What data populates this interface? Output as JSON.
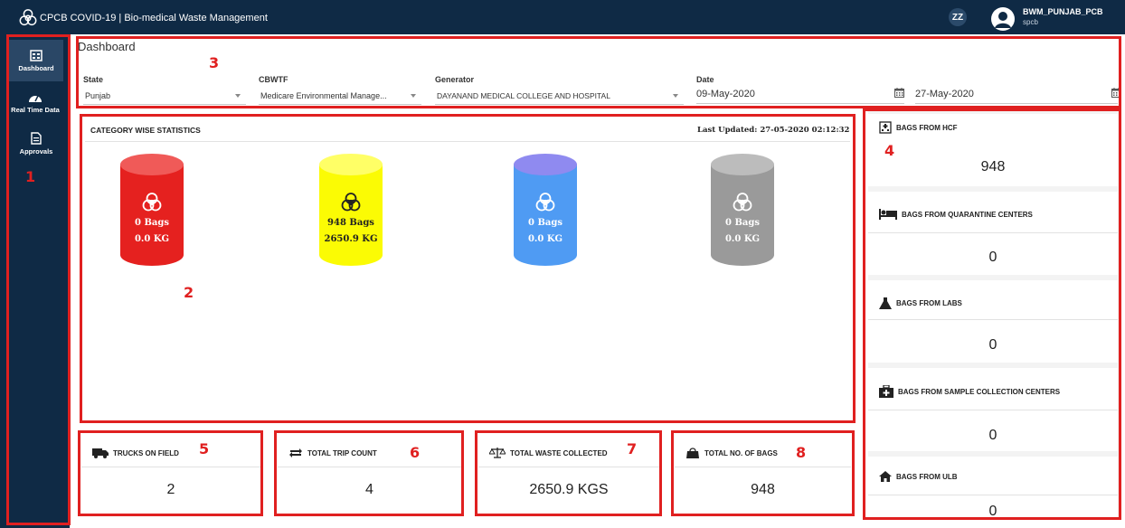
{
  "header": {
    "title": "CPCB COVID-19 | Bio-medical Waste Management",
    "user_name": "BWM_PUNJAB_PCB",
    "user_org": "spcb",
    "badge": "ZZ"
  },
  "sidebar": {
    "items": [
      {
        "label": "Dashboard",
        "icon": "dashboard-icon",
        "active": true
      },
      {
        "label": "Real Time Data",
        "icon": "speedometer-icon",
        "active": false
      },
      {
        "label": "Approvals",
        "icon": "document-icon",
        "active": false
      }
    ]
  },
  "filters": {
    "page_title": "Dashboard",
    "state": {
      "label": "State",
      "value": "Punjab"
    },
    "cbwtf": {
      "label": "CBWTF",
      "value": "Medicare Environmental Manage..."
    },
    "generator": {
      "label": "Generator",
      "value": "DAYANAND MEDICAL COLLEGE AND HOSPITAL"
    },
    "date": {
      "label": "Date",
      "from": "09-May-2020",
      "to": "27-May-2020"
    }
  },
  "category_stats": {
    "title": "CATEGORY WISE STATISTICS",
    "last_updated": "Last Updated: 27-05-2020 02:12:32",
    "cylinders": [
      {
        "bags": "0 Bags",
        "kg": "0.0 KG",
        "color": "#e5211f",
        "top": "#f05a58",
        "text": "#ffffff"
      },
      {
        "bags": "948 Bags",
        "kg": "2650.9 KG",
        "color": "#fbfb04",
        "top": "#ffff66",
        "text": "#222222"
      },
      {
        "bags": "0 Bags",
        "kg": "0.0 KG",
        "color": "#4f9bf3",
        "top": "#8f8af0",
        "text": "#ffffff"
      },
      {
        "bags": "0 Bags",
        "kg": "0.0 KG",
        "color": "#9a9a9a",
        "top": "#bcbcbc",
        "text": "#ffffff"
      }
    ]
  },
  "bottom_stats": [
    {
      "title": "TRUCKS ON FIELD",
      "value": "2",
      "icon": "truck-icon"
    },
    {
      "title": "TOTAL TRIP COUNT",
      "value": "4",
      "icon": "repeat-icon"
    },
    {
      "title": "TOTAL WASTE COLLECTED",
      "value": "2650.9 KGS",
      "icon": "scale-icon"
    },
    {
      "title": "TOTAL NO. OF BAGS",
      "value": "948",
      "icon": "bag-icon"
    }
  ],
  "right_stats": [
    {
      "title": "BAGS FROM HCF",
      "value": "948",
      "icon": "hospital-icon"
    },
    {
      "title": "BAGS FROM QUARANTINE CENTERS",
      "value": "0",
      "icon": "bed-icon"
    },
    {
      "title": "BAGS FROM LABS",
      "value": "0",
      "icon": "flask-icon"
    },
    {
      "title": "BAGS FROM SAMPLE COLLECTION CENTERS",
      "value": "0",
      "icon": "medkit-icon"
    },
    {
      "title": "BAGS FROM ULB",
      "value": "0",
      "icon": "home-icon"
    }
  ],
  "annotations": [
    "1",
    "2",
    "3",
    "4",
    "5",
    "6",
    "7",
    "8"
  ],
  "colors": {
    "nav": "#0f2a45",
    "annotation": "#e02020"
  }
}
